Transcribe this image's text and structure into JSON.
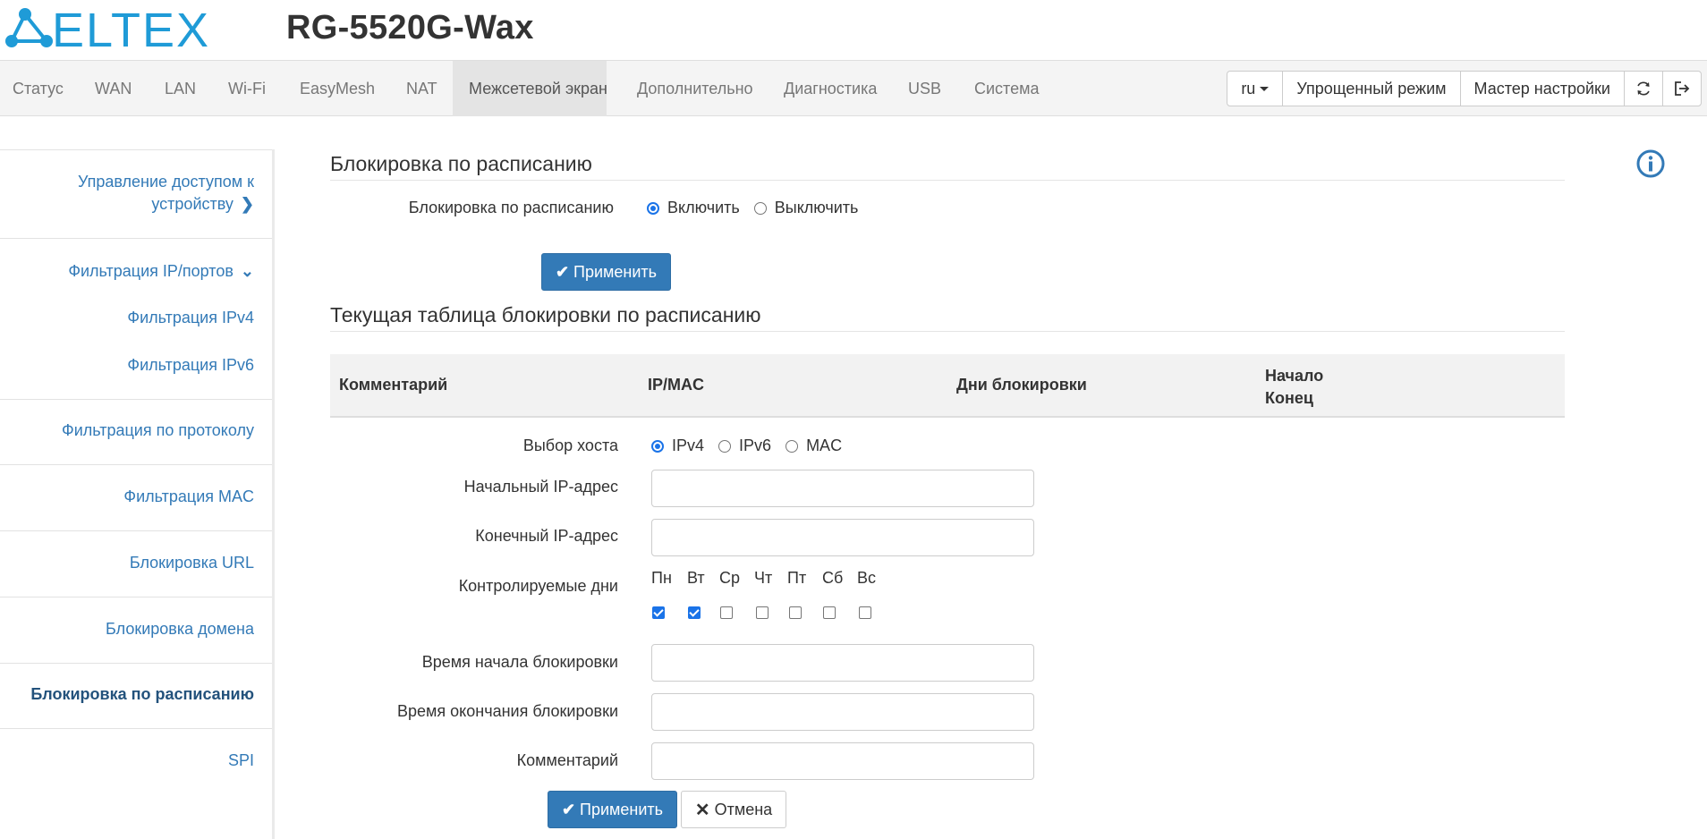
{
  "header": {
    "logo_text": "ELTEX",
    "model": "RG-5520G-Wax"
  },
  "nav": {
    "items": [
      {
        "label": "Статус"
      },
      {
        "label": "WAN"
      },
      {
        "label": "LAN"
      },
      {
        "label": "Wi-Fi"
      },
      {
        "label": "EasyMesh"
      },
      {
        "label": "NAT"
      },
      {
        "label": "Межсетевой экран",
        "active": true
      },
      {
        "label": "Дополнительно"
      },
      {
        "label": "Диагностика"
      },
      {
        "label": "USB"
      },
      {
        "label": "Система"
      }
    ],
    "lang": "ru",
    "simple_mode": "Упрощенный режим",
    "wizard": "Мастер настройки",
    "refresh_icon": "refresh-icon",
    "logout_icon": "logout-icon"
  },
  "sidebar": {
    "items": [
      {
        "label_line1": "Управление доступом к",
        "label_line2": "устройству",
        "icon": "chevron-right-icon"
      },
      {
        "label": "Фильтрация IP/портов",
        "icon": "chevron-down-icon"
      },
      {
        "label": "Фильтрация IPv4"
      },
      {
        "label": "Фильтрация IPv6"
      },
      {
        "label": "Фильтрация по протоколу"
      },
      {
        "label": "Фильтрация MAC"
      },
      {
        "label": "Блокировка URL"
      },
      {
        "label": "Блокировка домена"
      },
      {
        "label": "Блокировка по расписанию",
        "active": true
      },
      {
        "label": "SPI"
      }
    ]
  },
  "schedule": {
    "title": "Блокировка по расписанию",
    "field_label": "Блокировка по расписанию",
    "options": [
      "Включить",
      "Выключить"
    ],
    "selected": "Включить",
    "apply": "Применить"
  },
  "table": {
    "title": "Текущая таблица блокировки по расписанию",
    "columns": [
      "Комментарий",
      "IP/MAC",
      "Дни блокировки"
    ],
    "time_col_line1": "Начало",
    "time_col_line2": "Конец"
  },
  "form": {
    "host_label": "Выбор хоста",
    "host_options": [
      "IPv4",
      "IPv6",
      "MAC"
    ],
    "host_selected": "IPv4",
    "start_ip_label": "Начальный IP-адрес",
    "start_ip_value": "",
    "end_ip_label": "Конечный IP-адрес",
    "end_ip_value": "",
    "days_label": "Контролируемые дни",
    "days": [
      {
        "label": "Пн",
        "checked": true
      },
      {
        "label": "Вт",
        "checked": true
      },
      {
        "label": "Ср",
        "checked": false
      },
      {
        "label": "Чт",
        "checked": false
      },
      {
        "label": "Пт",
        "checked": false
      },
      {
        "label": "Сб",
        "checked": false
      },
      {
        "label": "Вс",
        "checked": false
      }
    ],
    "start_time_label": "Время начала блокировки",
    "start_time_value": "",
    "end_time_label": "Время окончания блокировки",
    "end_time_value": "",
    "comment_label": "Комментарий",
    "comment_value": "",
    "apply": "Применить",
    "cancel": "Отмена"
  },
  "colors": {
    "accent": "#337ab7",
    "logo": "#1f9bd7"
  }
}
